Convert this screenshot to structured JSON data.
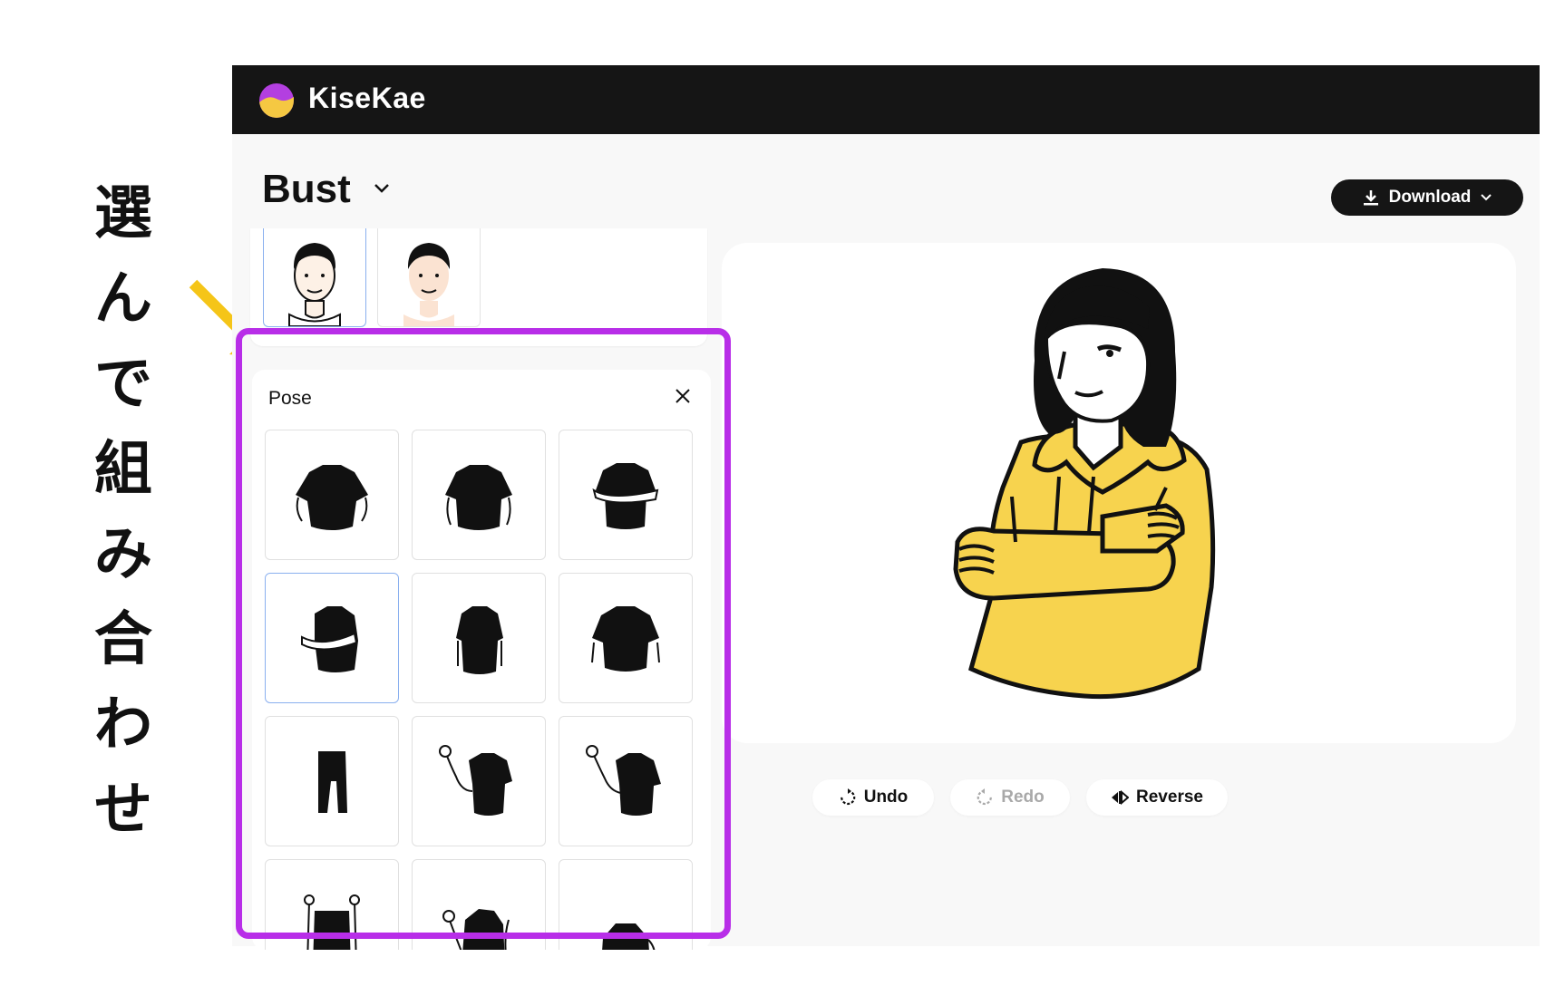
{
  "caption": {
    "chars": [
      "選",
      "ん",
      "で",
      "組",
      "み",
      "合",
      "わ",
      "せ"
    ]
  },
  "topbar": {
    "brand": "KiseKae"
  },
  "header": {
    "view_title": "Bust",
    "download_label": "Download"
  },
  "pose_panel": {
    "title": "Pose"
  },
  "actions": {
    "undo_label": "Undo",
    "redo_label": "Redo",
    "reverse_label": "Reverse"
  },
  "colors": {
    "topbar": "#151515",
    "highlight": "#b82ee8",
    "arrow": "#f5c518",
    "hoodie": "#f7d34e",
    "selected_border": "#8ab0ef"
  }
}
